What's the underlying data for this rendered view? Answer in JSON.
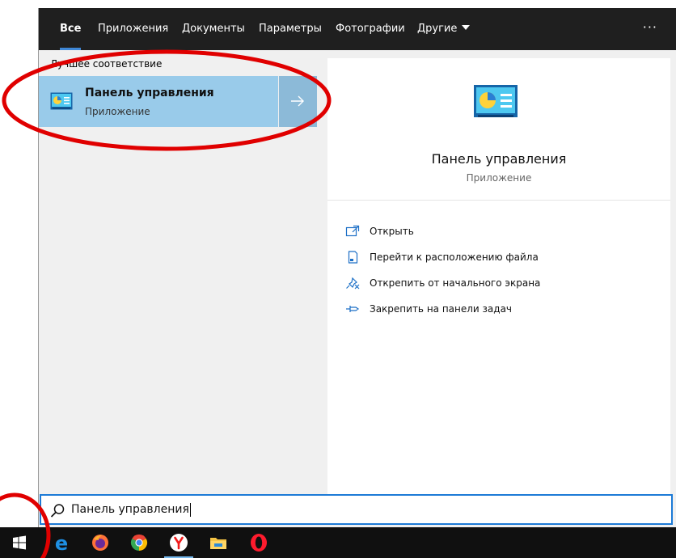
{
  "tabs": [
    {
      "label": "Все"
    },
    {
      "label": "Приложения"
    },
    {
      "label": "Документы"
    },
    {
      "label": "Параметры"
    },
    {
      "label": "Фотографии"
    },
    {
      "label": "Другие"
    }
  ],
  "more_label": "···",
  "results": {
    "section_title": "Лучшее соответствие",
    "best_match": {
      "name": "Панель управления",
      "type": "Приложение"
    }
  },
  "details": {
    "title": "Панель управления",
    "type": "Приложение",
    "actions": [
      {
        "label": "Открыть",
        "icon": "open-icon"
      },
      {
        "label": "Перейти к расположению файла",
        "icon": "file-location-icon"
      },
      {
        "label": "Открепить от начального экрана",
        "icon": "unpin-icon"
      },
      {
        "label": "Закрепить на панели задач",
        "icon": "pin-icon"
      }
    ]
  },
  "search": {
    "query": "Панель управления"
  },
  "taskbar": {
    "items": [
      "start-icon",
      "edge-icon",
      "firefox-icon",
      "chrome-icon",
      "yandex-browser-icon",
      "file-explorer-icon",
      "opera-icon"
    ]
  },
  "colors": {
    "tab_bar": "#1f1f1f",
    "accent": "#3f87d6",
    "selected_result": "#99cbea",
    "annotation": "#e00000"
  }
}
